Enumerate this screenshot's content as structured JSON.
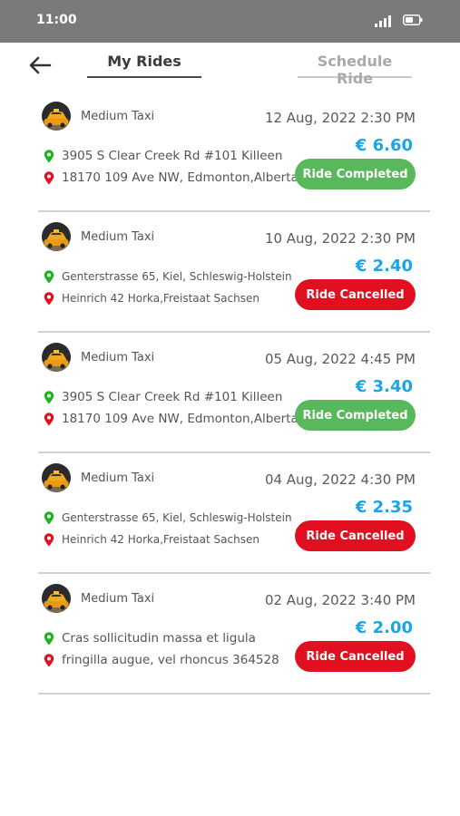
{
  "status_bar": {
    "time": "11:00",
    "signal_icon": "signal-bars-icon",
    "battery_icon": "battery-icon"
  },
  "header": {
    "back_icon": "arrow-left-icon",
    "tabs": [
      {
        "label": "My Rides",
        "active": true
      },
      {
        "label": "Schedule Ride",
        "active": false
      }
    ]
  },
  "colors": {
    "fare": "#1aa6e6",
    "completed": "#5ab85c",
    "cancelled": "#e01020",
    "pickup_pin": "#1db31d",
    "drop_pin": "#e01020"
  },
  "rides": [
    {
      "vehicle": "Medium Taxi",
      "date": "12 Aug, 2022  2:30 PM",
      "fare": "€ 6.60",
      "pickup": "3905 S Clear Creek Rd #101 Killeen",
      "drop": "18170 109 Ave NW, Edmonton,Alberta",
      "status": "Ride Completed",
      "status_type": "completed"
    },
    {
      "vehicle": "Medium Taxi",
      "date": "10 Aug, 2022  2:30 PM",
      "fare": "€ 2.40",
      "pickup": "Genterstrasse 65, Kiel, Schleswig-Holstein",
      "drop": "Heinrich 42 Horka,Freistaat Sachsen",
      "status": "Ride Cancelled",
      "status_type": "cancelled"
    },
    {
      "vehicle": "Medium Taxi",
      "date": "05 Aug, 2022  4:45 PM",
      "fare": "€ 3.40",
      "pickup": "3905 S Clear Creek Rd #101 Killeen",
      "drop": "18170 109 Ave NW, Edmonton,Alberta",
      "status": "Ride Completed",
      "status_type": "completed"
    },
    {
      "vehicle": "Medium Taxi",
      "date": "04 Aug, 2022  4:30 PM",
      "fare": "€ 2.35",
      "pickup": "Genterstrasse 65, Kiel, Schleswig-Holstein",
      "drop": "Heinrich 42 Horka,Freistaat Sachsen",
      "status": "Ride Cancelled",
      "status_type": "cancelled"
    },
    {
      "vehicle": "Medium Taxi",
      "date": "02 Aug, 2022  3:40 PM",
      "fare": "€ 2.00",
      "pickup": "Cras sollicitudin massa et ligula",
      "drop": "fringilla augue, vel rhoncus 364528",
      "status": "Ride Cancelled",
      "status_type": "cancelled"
    }
  ],
  "icons": {
    "pickup": "pickup-pin-icon",
    "drop": "drop-pin-icon",
    "avatar": "taxi-avatar"
  }
}
